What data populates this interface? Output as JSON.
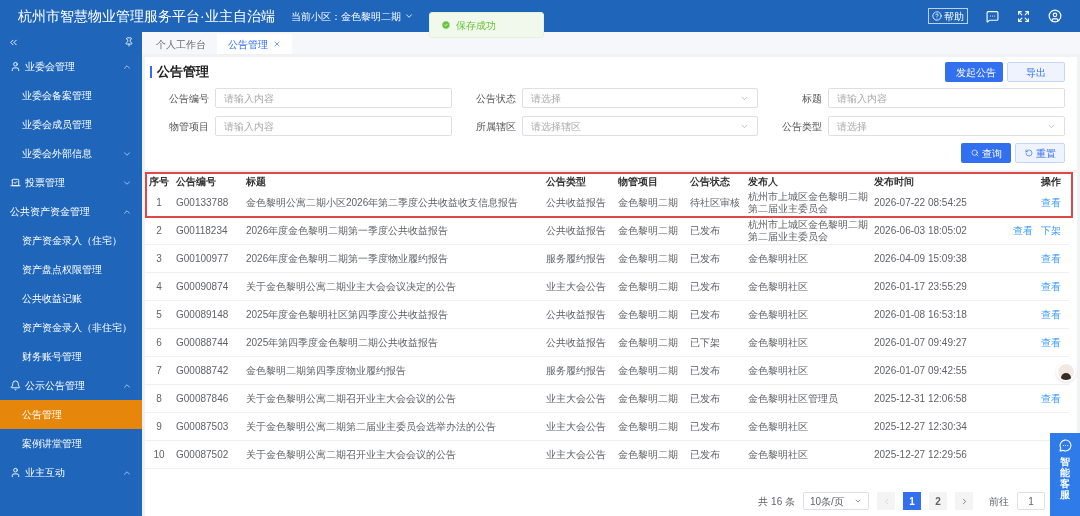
{
  "header": {
    "title": "杭州市智慧物业管理服务平台·业主自治端",
    "community_label": "当前小区：",
    "community": "金色黎明二期",
    "help": "帮助"
  },
  "toast": {
    "text": "保存成功"
  },
  "sidebar": {
    "items": [
      {
        "label": "业委会管理",
        "expanded": true,
        "children": [
          {
            "label": "业委会备案管理",
            "selected": false
          },
          {
            "label": "业委会成员管理",
            "selected": false
          },
          {
            "label": "业委会外部信息",
            "selected": false,
            "expandable": true
          }
        ]
      },
      {
        "label": "投票管理",
        "expanded": false
      },
      {
        "label": "公共资产资金管理",
        "expanded": true,
        "children": [
          {
            "label": "资产资金录入（住宅）",
            "selected": false
          },
          {
            "label": "资产盘点权限管理",
            "selected": false
          },
          {
            "label": "公共收益记账",
            "selected": false
          },
          {
            "label": "资产资金录入（非住宅）",
            "selected": false
          },
          {
            "label": "财务账号管理",
            "selected": false
          }
        ]
      },
      {
        "label": "公示公告管理",
        "expanded": true,
        "children": [
          {
            "label": "公告管理",
            "selected": true
          },
          {
            "label": "案例讲堂管理",
            "selected": false
          }
        ]
      },
      {
        "label": "业主互动",
        "expanded": true
      }
    ]
  },
  "tabs": [
    {
      "label": "个人工作台",
      "selected": false,
      "closable": false
    },
    {
      "label": "公告管理",
      "selected": true,
      "closable": true
    }
  ],
  "page_title": "公告管理",
  "top_buttons": [
    {
      "label": "发起公告",
      "kind": "primary"
    },
    {
      "label": "导出",
      "kind": "plain"
    }
  ],
  "filters": [
    {
      "label": "公告编号",
      "placeholder": "请输入内容",
      "kind": "input"
    },
    {
      "label": "公告状态",
      "placeholder": "请选择",
      "kind": "select"
    },
    {
      "label": "标题",
      "placeholder": "请输入内容",
      "kind": "input"
    },
    {
      "label": "物管项目",
      "placeholder": "请输入内容",
      "kind": "input"
    },
    {
      "label": "所属辖区",
      "placeholder": "请选择辖区",
      "kind": "select"
    },
    {
      "label": "公告类型",
      "placeholder": "请选择",
      "kind": "select"
    }
  ],
  "filter_buttons": [
    {
      "label": "查询",
      "kind": "primary"
    },
    {
      "label": "重置",
      "kind": "plain"
    }
  ],
  "table": {
    "columns": [
      "序号",
      "公告编号",
      "标题",
      "公告类型",
      "物管项目",
      "公告状态",
      "发布人",
      "发布时间",
      "操作"
    ],
    "rows": [
      {
        "highlighted": true,
        "cells": [
          "1",
          "G00133788",
          "金色黎明公寓二期小区2026年第二季度公共收益收支信息报告",
          "公共收益报告",
          "金色黎明二期",
          "待社区审核",
          "杭州市上城区金色黎明二期第二届业主委员会",
          "2026-07-22 08:54:25"
        ],
        "actions": [
          "查看"
        ]
      },
      {
        "highlighted": false,
        "cells": [
          "2",
          "G00118234",
          "2026年度金色黎明二期第一季度公共收益报告",
          "公共收益报告",
          "金色黎明二期",
          "已发布",
          "杭州市上城区金色黎明二期第二届业主委员会",
          "2026-06-03 18:05:02"
        ],
        "actions": [
          "查看",
          "下架"
        ]
      },
      {
        "highlighted": false,
        "cells": [
          "3",
          "G00100977",
          "2026年度金色黎明二期第一季度物业履约报告",
          "服务履约报告",
          "金色黎明二期",
          "已发布",
          "金色黎明社区",
          "2026-04-09 15:09:38"
        ],
        "actions": [
          "查看"
        ]
      },
      {
        "highlighted": false,
        "cells": [
          "4",
          "G00090874",
          "关于金色黎明公寓二期业主大会会议决定的公告",
          "业主大会公告",
          "金色黎明二期",
          "已发布",
          "金色黎明社区",
          "2026-01-17 23:55:29"
        ],
        "actions": [
          "查看"
        ]
      },
      {
        "highlighted": false,
        "cells": [
          "5",
          "G00089148",
          "2025年度金色黎明社区第四季度公共收益报告",
          "公共收益报告",
          "金色黎明二期",
          "已发布",
          "金色黎明社区",
          "2026-01-08 16:53:18"
        ],
        "actions": [
          "查看"
        ]
      },
      {
        "highlighted": false,
        "cells": [
          "6",
          "G00088744",
          "2025年第四季度金色黎明二期公共收益报告",
          "公共收益报告",
          "金色黎明二期",
          "已下架",
          "金色黎明社区",
          "2026-01-07 09:49:27"
        ],
        "actions": [
          "查看"
        ]
      },
      {
        "highlighted": false,
        "cells": [
          "7",
          "G00088742",
          "金色黎明二期第四季度物业履约报告",
          "服务履约报告",
          "金色黎明二期",
          "已发布",
          "金色黎明社区",
          "2026-01-07 09:42:55"
        ]
      },
      {
        "highlighted": false,
        "cells": [
          "8",
          "G00087846",
          "关于金色黎明公寓二期召开业主大会会议的公告",
          "业主大会公告",
          "金色黎明二期",
          "已发布",
          "金色黎明社区管理员",
          "2025-12-31 12:06:58"
        ],
        "actions": [
          "查看"
        ]
      },
      {
        "highlighted": false,
        "cells": [
          "9",
          "G00087503",
          "关于金色黎明公寓二期第二届业主委员会选举办法的公告",
          "业主大会公告",
          "金色黎明二期",
          "已发布",
          "金色黎明社区",
          "2025-12-27 12:30:34"
        ]
      },
      {
        "highlighted": false,
        "cells": [
          "10",
          "G00087502",
          "关于金色黎明公寓二期召开业主大会会议的公告",
          "业主大会公告",
          "金色黎明二期",
          "已发布",
          "金色黎明社区",
          "2025-12-27 12:29:56"
        ]
      }
    ]
  },
  "pagination": {
    "total": "共 16 条",
    "page_size": "10条/页",
    "pages": [
      {
        "label": "1",
        "selected": true
      },
      {
        "label": "2",
        "selected": false
      }
    ],
    "goto_label": "前往",
    "goto_value": "1"
  },
  "service_widget": {
    "label": "智能客服"
  }
}
